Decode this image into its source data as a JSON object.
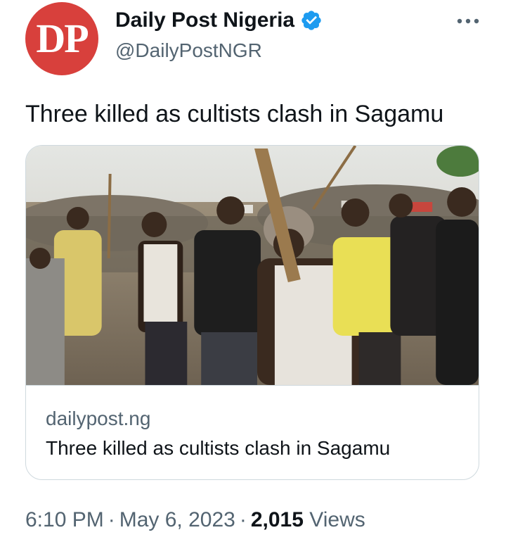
{
  "author": {
    "avatar_text": "DP",
    "avatar_color": "#d8403c",
    "display_name": "Daily Post Nigeria",
    "handle": "@DailyPostNGR",
    "verified": true,
    "verified_color": "#1d9bf0"
  },
  "tweet": {
    "text": "Three killed as cultists clash in Sagamu"
  },
  "link_card": {
    "domain": "dailypost.ng",
    "title": "Three killed as cultists clash in Sagamu",
    "image_alt": "crowd of men carrying sticks"
  },
  "meta": {
    "time": "6:10 PM",
    "separator": "·",
    "date": "May 6, 2023",
    "views_count": "2,015",
    "views_label": "Views"
  },
  "icons": {
    "verified": "verified-badge-icon",
    "more": "more-options-icon"
  }
}
